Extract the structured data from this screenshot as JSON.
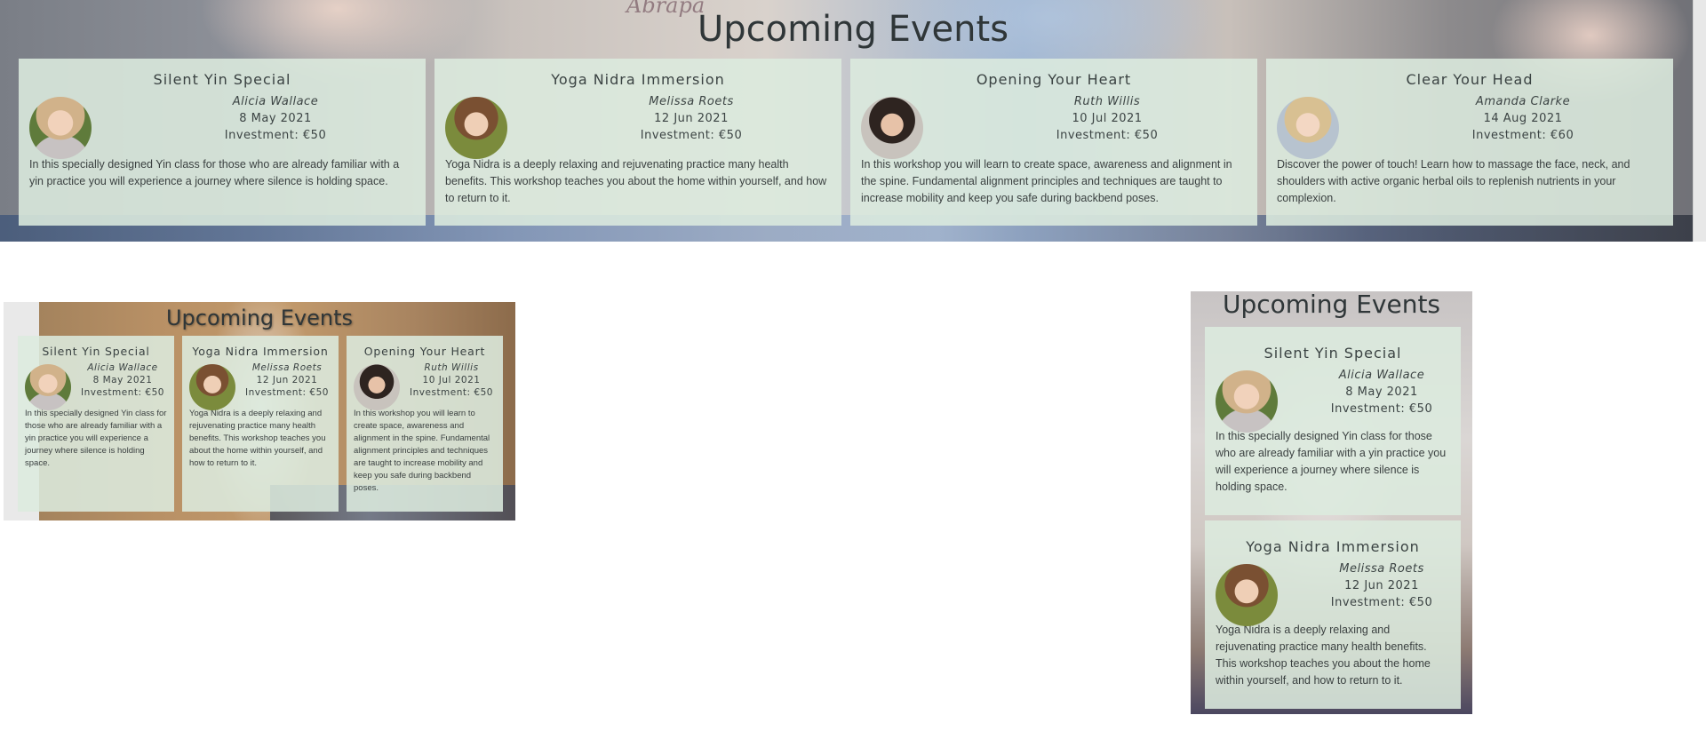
{
  "heading": "Upcoming Events",
  "events": [
    {
      "title": "Silent Yin Special",
      "teacher": "Alicia Wallace",
      "date": "8 May 2021",
      "price": "Investment: €50",
      "description": "In this specially designed Yin class for those who are already familiar with a yin practice you will experience a journey where silence is holding space.",
      "avatar_icon": "teacher-photo-alicia"
    },
    {
      "title": "Yoga Nidra Immersion",
      "teacher": "Melissa Roets",
      "date": "12 Jun 2021",
      "price": "Investment: €50",
      "description": "Yoga Nidra is a deeply relaxing and rejuvenating practice many health benefits. This workshop teaches you about the home within yourself, and how to return to it.",
      "avatar_icon": "teacher-photo-melissa"
    },
    {
      "title": "Opening Your Heart",
      "teacher": "Ruth Willis",
      "date": "10 Jul 2021",
      "price": "Investment: €50",
      "description": "In this workshop you will learn to create space, awareness and alignment in the spine. Fundamental alignment principles and techniques are taught to increase mobility and keep you safe during backbend poses.",
      "avatar_icon": "teacher-photo-ruth"
    },
    {
      "title": "Clear Your Head",
      "teacher": "Amanda Clarke",
      "date": "14 Aug 2021",
      "price": "Investment: €60",
      "description": "Discover the power of touch! Learn how to massage the face, neck, and shoulders with active organic herbal oils to replenish nutrients in your complexion.",
      "avatar_icon": "teacher-photo-amanda"
    }
  ],
  "background_script_text": "Abrapa",
  "colors": {
    "card_background": "#dceade",
    "heading_text": "#2f3638"
  }
}
